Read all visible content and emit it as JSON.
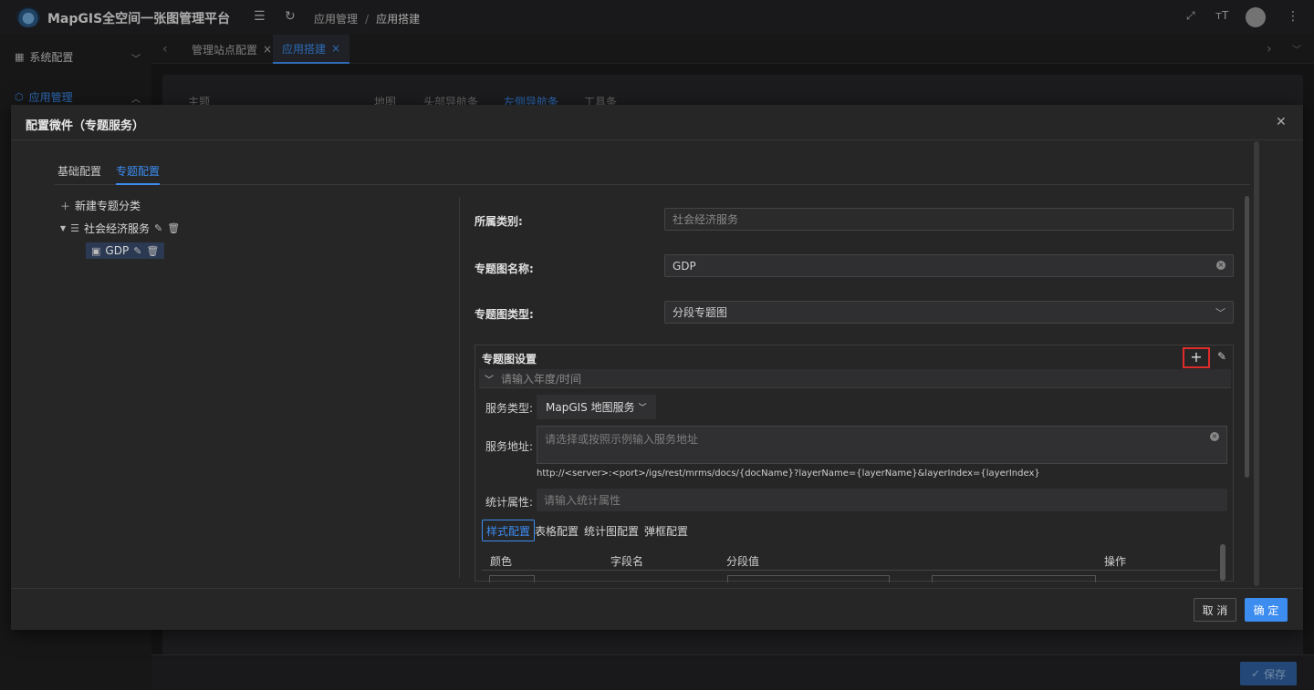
{
  "header": {
    "app_title": "MapGIS全空间一张图管理平台",
    "breadcrumb": [
      "应用管理",
      "应用搭建"
    ],
    "breadcrumb_sep": "/"
  },
  "sidebar": {
    "items": [
      {
        "label": "系统配置",
        "icon": "grid-icon"
      },
      {
        "label": "应用管理",
        "icon": "cube-icon"
      }
    ]
  },
  "tabs": [
    {
      "label": "管理站点配置"
    },
    {
      "label": "应用搭建"
    }
  ],
  "background": {
    "left_label": "主题",
    "tabs": [
      "地图",
      "头部导航条",
      "左侧导航条",
      "工具条"
    ],
    "save_label": "保存"
  },
  "modal": {
    "title": "配置微件（专题服务）",
    "tabs": [
      "基础配置",
      "专题配置"
    ],
    "tree": {
      "add_label": "新建专题分类",
      "category": "社会经济服务",
      "child": "GDP"
    },
    "form": {
      "category_label": "所属类别:",
      "category_value": "社会经济服务",
      "name_label": "专题图名称:",
      "name_value": "GDP",
      "type_label": "专题图类型:",
      "type_value": "分段专题图"
    },
    "panel": {
      "title": "专题图设置",
      "year_placeholder": "请输入年度/时间",
      "service_type_label": "服务类型:",
      "service_type_value": "MapGIS 地图服务",
      "service_url_label": "服务地址:",
      "service_url_placeholder": "请选择或按照示例输入服务地址",
      "url_hint": "http://<server>:<port>/igs/rest/mrms/docs/{docName}?layerName={layerName}&layerIndex={layerIndex}",
      "stat_label": "统计属性:",
      "stat_placeholder": "请输入统计属性",
      "subtabs": [
        "样式配置",
        "表格配置",
        "统计图配置",
        "弹框配置"
      ],
      "table_headers": [
        "颜色",
        "字段名",
        "分段值",
        "操作"
      ]
    },
    "cancel_label": "取 消",
    "ok_label": "确 定"
  },
  "colors": {
    "accent": "#3d8cf0",
    "highlight": "#e02b2b"
  }
}
